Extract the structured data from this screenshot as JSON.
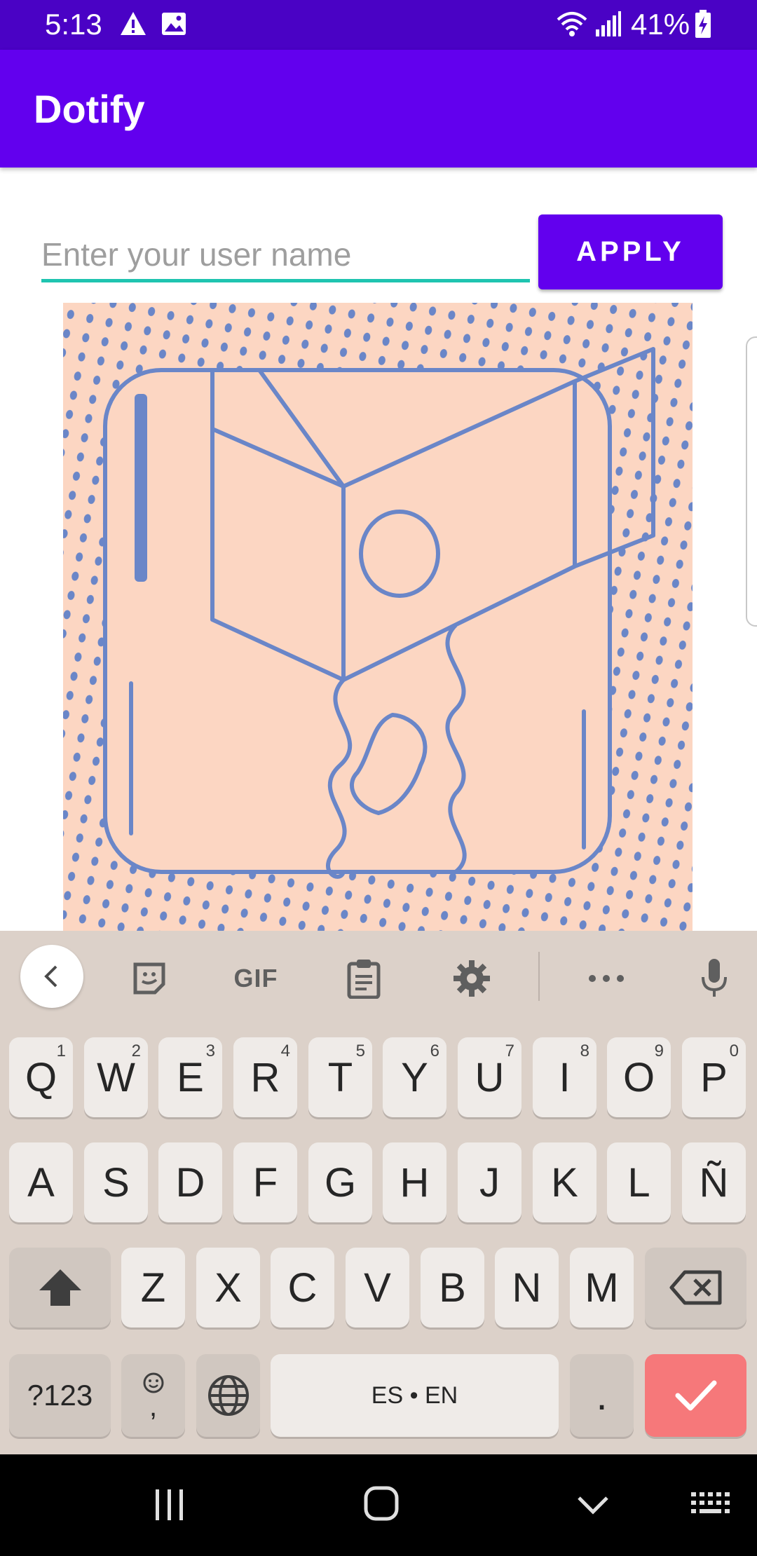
{
  "status_bar": {
    "time": "5:13",
    "battery": "41%",
    "icons": [
      "warning-icon",
      "image-icon",
      "wifi-icon",
      "signal-icon",
      "battery-charging-icon"
    ]
  },
  "app_bar": {
    "title": "Dotify"
  },
  "form": {
    "username_placeholder": "Enter your user name",
    "username_value": "",
    "apply_label": "APPLY"
  },
  "artwork": {
    "background_color": "#fcd6c2",
    "line_color": "#6a86c8"
  },
  "keyboard": {
    "toolbar": [
      "back-icon",
      "sticker-icon",
      "GIF",
      "clipboard-icon",
      "settings-icon",
      "more-icon",
      "microphone-icon"
    ],
    "gif_label": "GIF",
    "row1": [
      {
        "label": "Q",
        "alt": "1"
      },
      {
        "label": "W",
        "alt": "2"
      },
      {
        "label": "E",
        "alt": "3"
      },
      {
        "label": "R",
        "alt": "4"
      },
      {
        "label": "T",
        "alt": "5"
      },
      {
        "label": "Y",
        "alt": "6"
      },
      {
        "label": "U",
        "alt": "7"
      },
      {
        "label": "I",
        "alt": "8"
      },
      {
        "label": "O",
        "alt": "9"
      },
      {
        "label": "P",
        "alt": "0"
      }
    ],
    "row2": [
      "A",
      "S",
      "D",
      "F",
      "G",
      "H",
      "J",
      "K",
      "L",
      "Ñ"
    ],
    "row3": [
      "Z",
      "X",
      "C",
      "V",
      "B",
      "N",
      "M"
    ],
    "symbols_label": "?123",
    "comma_label": ",",
    "space_label": "ES • EN",
    "period_label": ".",
    "enter_color": "#f6787a"
  },
  "nav_bar": {
    "icons": [
      "recent-apps-icon",
      "home-icon",
      "back-down-icon",
      "keyboard-icon"
    ]
  }
}
